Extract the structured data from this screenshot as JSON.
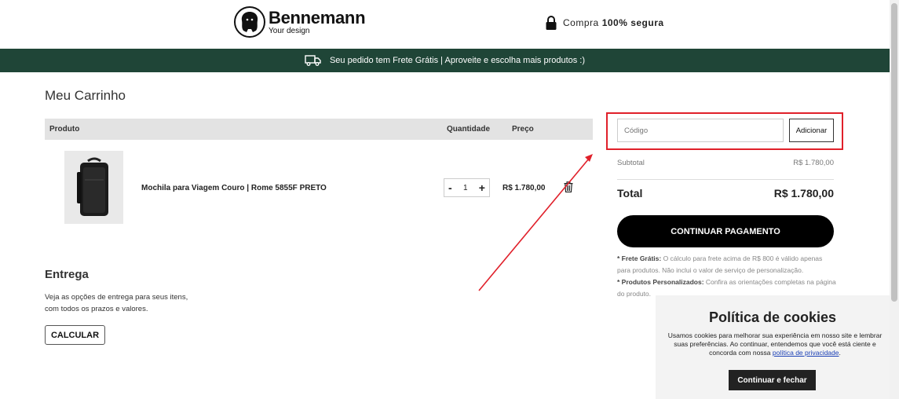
{
  "header": {
    "brand": "Bennemann",
    "tagline": "Your design",
    "secure_prefix": "Compra",
    "secure_bold": "100% segura"
  },
  "banner": {
    "text": "Seu pedido tem Frete Grátis | Aproveite e escolha mais produtos :)"
  },
  "cart": {
    "title": "Meu Carrinho",
    "columns": {
      "product": "Produto",
      "quantity": "Quantidade",
      "price": "Preço"
    },
    "items": [
      {
        "name": "Mochila para Viagem Couro | Rome 5855F PRETO",
        "quantity": "1",
        "price": "R$ 1.780,00",
        "minus": "-",
        "plus": "+"
      }
    ]
  },
  "shipping": {
    "title": "Entrega",
    "description": "Veja as opções de entrega para seus itens, com todos os prazos e valores.",
    "button": "CALCULAR"
  },
  "summary": {
    "coupon_placeholder": "Código",
    "coupon_button": "Adicionar",
    "subtotal_label": "Subtotal",
    "subtotal_value": "R$ 1.780,00",
    "total_label": "Total",
    "total_value": "R$ 1.780,00",
    "pay_button": "CONTINUAR PAGAMENTO",
    "note1_label": "* Frete Grátis:",
    "note1_text": " O cálculo para frete acima de R$ 800 é válido apenas para produtos. Não inclui o valor de serviço de personalização.",
    "note2_label": "* Produtos Personalizados:",
    "note2_text": " Confira as orientações completas na página do produto."
  },
  "cookie": {
    "title": "Política de cookies",
    "text": "Usamos cookies para melhorar sua experiência em nosso site e lembrar suas preferências. Ao continuar, entendemos que você está ciente e concorda com nossa ",
    "link": "política de privacidade",
    "text_end": ".",
    "button": "Continuar e fechar"
  },
  "colors": {
    "banner": "#1f4537",
    "annotation": "#e0202a"
  }
}
